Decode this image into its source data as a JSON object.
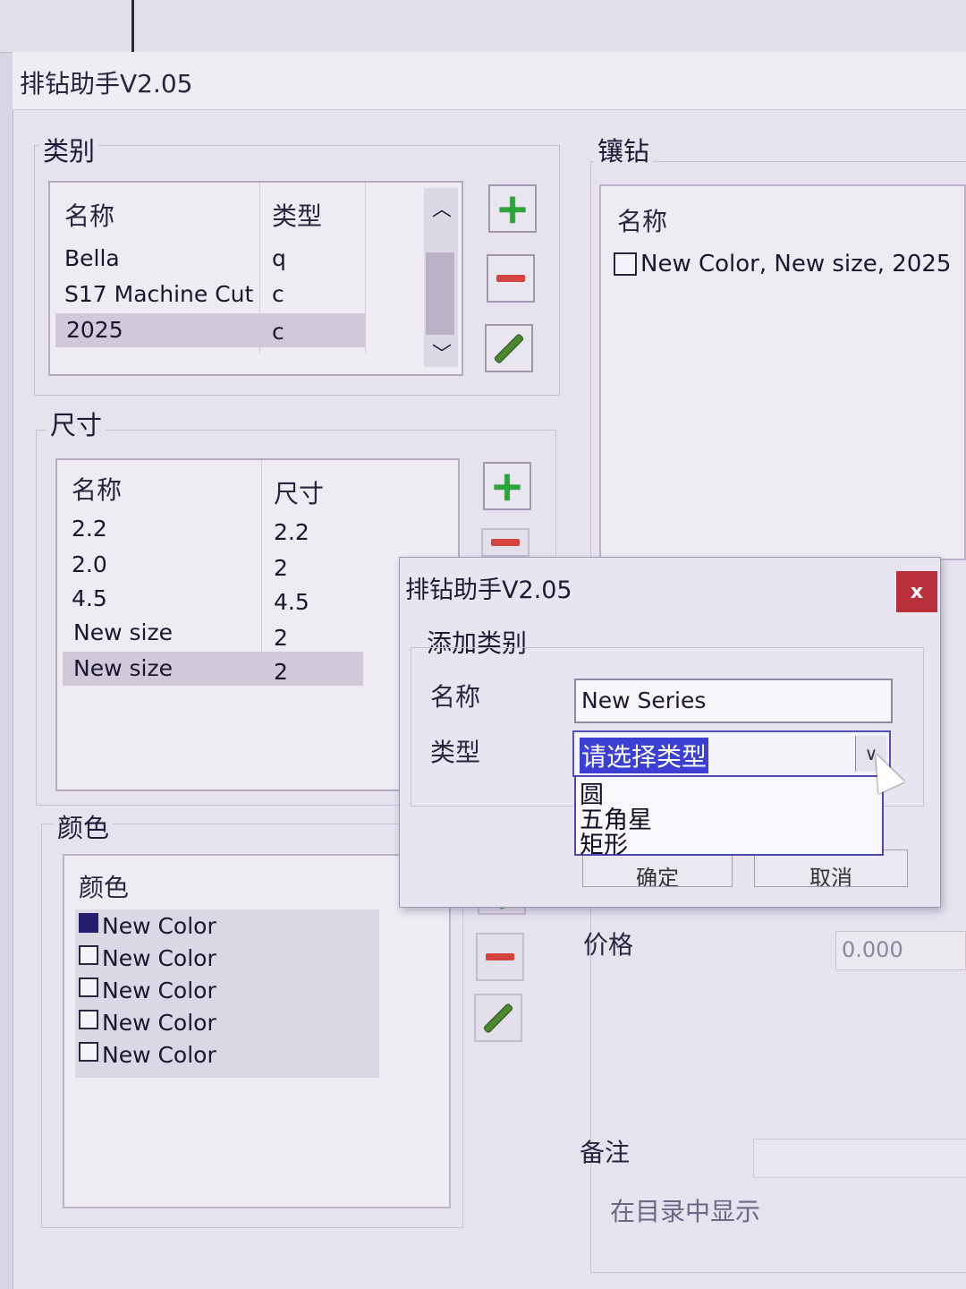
{
  "window": {
    "title": "排钻助手V2.05"
  },
  "category": {
    "group_title": "类别",
    "headers": [
      "名称",
      "类型"
    ],
    "rows": [
      {
        "name": "Bella",
        "type": "q"
      },
      {
        "name": "S17 Machine Cut",
        "type": "c"
      },
      {
        "name": "2025",
        "type": "c"
      }
    ],
    "selected_index": 2
  },
  "size": {
    "group_title": "尺寸",
    "headers": [
      "名称",
      "尺寸"
    ],
    "rows": [
      {
        "name": "2.2",
        "size": "2.2"
      },
      {
        "name": "2.0",
        "size": "2"
      },
      {
        "name": "4.5",
        "size": "4.5"
      },
      {
        "name": "New size",
        "size": "2"
      },
      {
        "name": "New size",
        "size": "2"
      }
    ],
    "selected_index": 4
  },
  "color": {
    "group_title": "颜色",
    "header": "颜色",
    "items": [
      "New Color",
      "New Color",
      "New Color",
      "New Color",
      "New Color"
    ],
    "swatch_colors": [
      "#231f6e",
      "#ffffff",
      "#ffffff",
      "#ffffff",
      "#ffffff"
    ]
  },
  "inlay": {
    "group_title": "镶钻",
    "header": "名称",
    "items": [
      "New Color, New size, 2025"
    ]
  },
  "right_form": {
    "price_label": "价格",
    "price_value": "0.000",
    "remark_label": "备注",
    "show_in_catalog_label": "在目录中显示"
  },
  "dialog": {
    "title": "排钻助手V2.05",
    "close_label": "x",
    "section_title": "添加类别",
    "name_label": "名称",
    "name_value": "New Series",
    "type_label": "类型",
    "type_placeholder": "请选择类型",
    "type_options": [
      "圆",
      "五角星",
      "矩形"
    ],
    "ok_label": "确定",
    "cancel_label": "取消"
  },
  "colors": {
    "add": "#2aa53a",
    "remove": "#d4433d",
    "edit": "#4a8a2e",
    "close": "#b8303a",
    "selection": "#3b3fd4"
  }
}
